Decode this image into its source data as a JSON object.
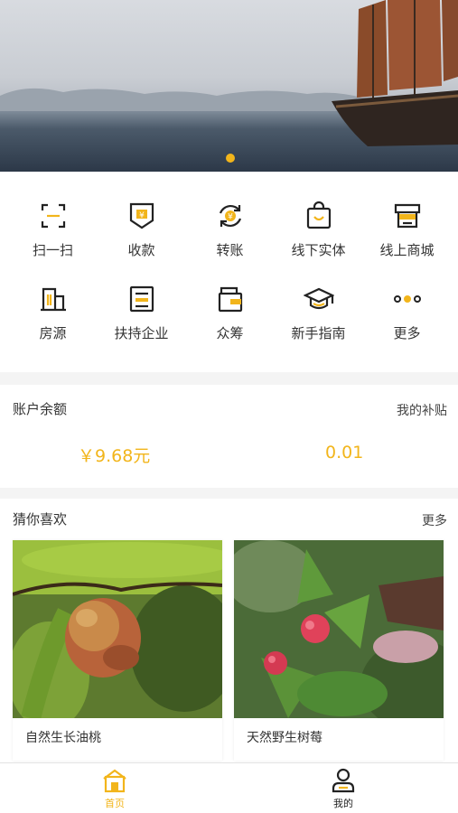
{
  "colors": {
    "accent": "#f2b51b",
    "text": "#333333",
    "muted": "#444444",
    "background": "#f4f4f4"
  },
  "banner": {
    "icon": "carousel-image",
    "active_page": 1
  },
  "grid": {
    "items": [
      {
        "label": "扫一扫",
        "icon": "scan-icon"
      },
      {
        "label": "收款",
        "icon": "receive-money-icon"
      },
      {
        "label": "转账",
        "icon": "transfer-icon"
      },
      {
        "label": "线下实体",
        "icon": "shopping-bag-icon"
      },
      {
        "label": "线上商城",
        "icon": "store-icon"
      },
      {
        "label": "房源",
        "icon": "building-icon"
      },
      {
        "label": "扶持企业",
        "icon": "document-icon"
      },
      {
        "label": "众筹",
        "icon": "wallet-icon"
      },
      {
        "label": "新手指南",
        "icon": "graduation-cap-icon"
      },
      {
        "label": "更多",
        "icon": "more-dots-icon"
      }
    ]
  },
  "balance": {
    "title": "账户余额",
    "subsidy_link": "我的补贴",
    "amount": "￥9.68元",
    "subsidy_amount": "0.01"
  },
  "recommend": {
    "title": "猜你喜欢",
    "more": "更多",
    "products": [
      {
        "name": "自然生长油桃",
        "image": "nectarine-photo"
      },
      {
        "name": "天然野生树莓",
        "image": "raspberry-photo"
      }
    ]
  },
  "tabbar": {
    "tabs": [
      {
        "label": "首页",
        "icon": "home-icon",
        "active": true
      },
      {
        "label": "我的",
        "icon": "user-icon",
        "active": false
      }
    ]
  }
}
